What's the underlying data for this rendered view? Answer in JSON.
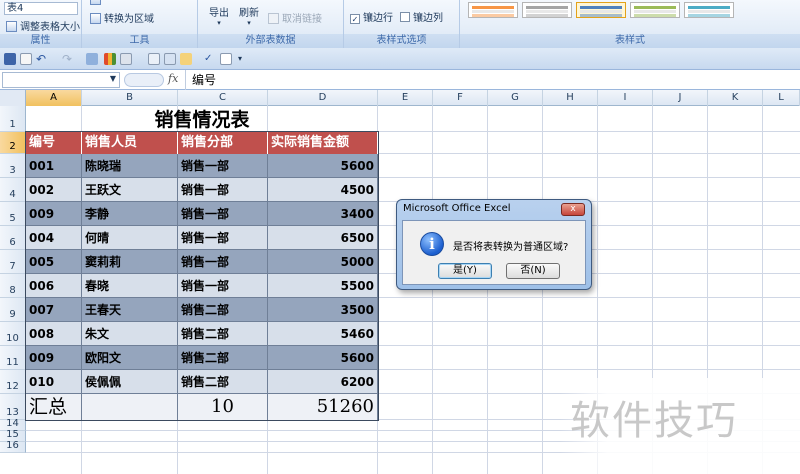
{
  "ribbon": {
    "props_group": {
      "table_name": "表4",
      "resize_label": "调整表格大小",
      "label": "属性"
    },
    "tools_group": {
      "convert_label": "转换为区域",
      "label": "工具"
    },
    "external_group": {
      "export_label": "导出",
      "refresh_label": "刷新",
      "unlink_label": "取消链接",
      "label": "外部表数据"
    },
    "style_options_group": {
      "banded_rows_label": "镶边行",
      "banded_cols_label": "镶边列",
      "label": "表样式选项"
    },
    "styles_group": {
      "label": "表样式",
      "swatch_colors": [
        "#f79646",
        "#a5a5a5",
        "#4f81bd",
        "#9bbb59",
        "#4bacc6"
      ]
    }
  },
  "formula_bar": {
    "name_box": "",
    "fx": "fx",
    "content": "编号"
  },
  "columns": [
    "A",
    "B",
    "C",
    "D",
    "E",
    "F",
    "G",
    "H",
    "I",
    "J",
    "K",
    "L"
  ],
  "rows": [
    "1",
    "2",
    "3",
    "4",
    "5",
    "6",
    "7",
    "8",
    "9",
    "10",
    "11",
    "12",
    "13",
    "14",
    "15",
    "16"
  ],
  "table": {
    "title": "销售情况表",
    "headers": [
      "编号",
      "销售人员",
      "销售分部",
      "实际销售金额"
    ],
    "records": [
      [
        "001",
        "陈晓瑞",
        "销售一部",
        "5600"
      ],
      [
        "002",
        "王跃文",
        "销售一部",
        "4500"
      ],
      [
        "009",
        "李静",
        "销售一部",
        "3400"
      ],
      [
        "004",
        "何晴",
        "销售一部",
        "6500"
      ],
      [
        "005",
        "窦莉莉",
        "销售一部",
        "5000"
      ],
      [
        "006",
        "春晓",
        "销售一部",
        "5500"
      ],
      [
        "007",
        "王春天",
        "销售二部",
        "3500"
      ],
      [
        "008",
        "朱文",
        "销售二部",
        "5460"
      ],
      [
        "009",
        "欧阳文",
        "销售二部",
        "5600"
      ],
      [
        "010",
        "侯佩佩",
        "销售二部",
        "6200"
      ]
    ],
    "total": {
      "label": "汇总",
      "count": "10",
      "sum": "51260"
    }
  },
  "dialog": {
    "title": "Microsoft Office Excel",
    "close": "x",
    "message": "是否将表转换为普通区域?",
    "yes": "是(Y)",
    "no": "否(N)",
    "icon": "i"
  },
  "watermark": "软件技巧"
}
